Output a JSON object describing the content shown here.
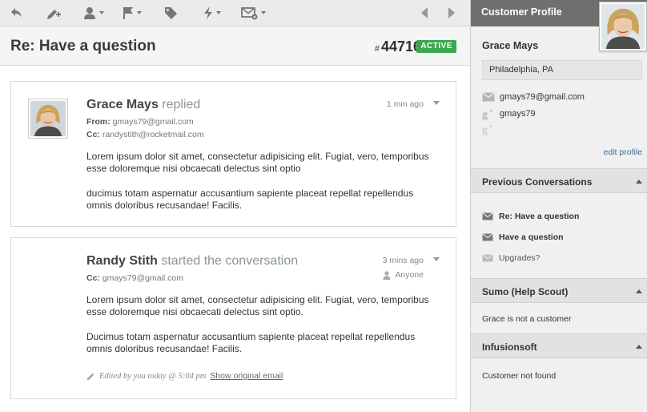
{
  "toolbar": {
    "buttons": [
      "reply-icon",
      "note-icon",
      "assign-icon",
      "flag-icon",
      "tag-icon",
      "workflow-icon",
      "email-settings-icon"
    ],
    "nav": [
      "prev-conversation-icon",
      "next-conversation-icon"
    ]
  },
  "conversation": {
    "title": "Re: Have a question",
    "number_prefix": "#",
    "number": "44716",
    "status": "ACTIVE"
  },
  "threads": [
    {
      "author": "Grace Mays",
      "action": "replied",
      "from_label": "From:",
      "from": "gmays79@gmail.com",
      "cc_label": "Cc:",
      "cc": "randystith@rocketmail.com",
      "time": "1 min ago",
      "paragraphs": [
        "Lorem ipsum dolor sit amet, consectetur adipisicing elit. Fugiat, vero, temporibus esse doloremque nisi obcaecati delectus sint optio",
        "ducimus totam aspernatur accusantium sapiente placeat repellat repellendus omnis doloribus recusandae! Facilis."
      ]
    },
    {
      "author": "Randy Stith",
      "action": "started the conversation",
      "cc_label": "Cc:",
      "cc": "gmays79@gmail.com",
      "time": "3 mins ago",
      "assignee": "Anyone",
      "paragraphs": [
        "Lorem ipsum dolor sit amet, consectetur adipisicing elit. Fugiat, vero, temporibus esse doloremque nisi obcaecati delectus sint optio.",
        "Ducimus totam aspernatur accusantium sapiente placeat repellat repellendus omnis doloribus recusandae! Facilis."
      ],
      "edited_note": "Edited by you today @ 5:04 pm",
      "show_original": "Show original email"
    }
  ],
  "sidebar": {
    "header": "Customer Profile",
    "name": "Grace Mays",
    "location": "Philadelphia, PA",
    "email": "gmays79@gmail.com",
    "gplus": "gmays79",
    "edit_profile": "edit profile",
    "sections": {
      "previous": {
        "title": "Previous Conversations",
        "items": [
          "Re: Have a question",
          "Have a question",
          "Upgrades?"
        ]
      },
      "sumo": {
        "title": "Sumo (Help Scout)",
        "text": "Grace is not a customer"
      },
      "infusionsoft": {
        "title": "Infusionsoft",
        "text": "Customer not found"
      }
    }
  },
  "colors": {
    "status_active": "#3aa84e",
    "sidebar_header": "#6f6f6f",
    "link": "#3d6d9b"
  }
}
